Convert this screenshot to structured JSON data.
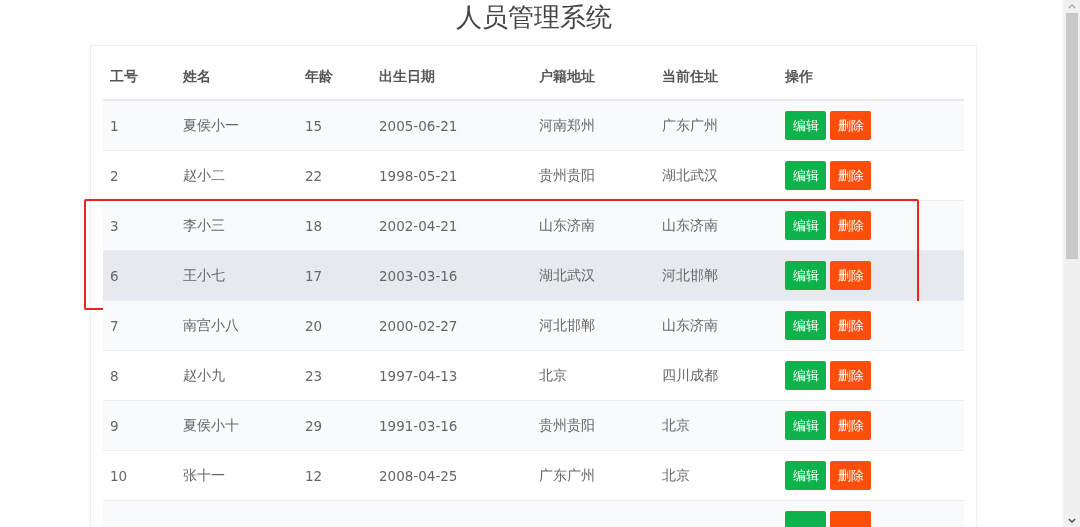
{
  "title": "人员管理系统",
  "table": {
    "columns": [
      "工号",
      "姓名",
      "年龄",
      "出生日期",
      "户籍地址",
      "当前住址",
      "操作"
    ],
    "rows": [
      {
        "cells": [
          "1",
          "夏侯小一",
          "15",
          "2005-06-21",
          "河南郑州",
          "广东广州"
        ],
        "actions": [
          "编辑",
          "删除"
        ],
        "hovered": false,
        "boxed": false
      },
      {
        "cells": [
          "2",
          "赵小二",
          "22",
          "1998-05-21",
          "贵州贵阳",
          "湖北武汉"
        ],
        "actions": [
          "编辑",
          "删除"
        ],
        "hovered": false,
        "boxed": false
      },
      {
        "cells": [
          "3",
          "李小三",
          "18",
          "2002-04-21",
          "山东济南",
          "山东济南"
        ],
        "actions": [
          "编辑",
          "删除"
        ],
        "hovered": false,
        "boxed": true
      },
      {
        "cells": [
          "6",
          "王小七",
          "17",
          "2003-03-16",
          "湖北武汉",
          "河北邯郸"
        ],
        "actions": [
          "编辑",
          "删除"
        ],
        "hovered": true,
        "boxed": true
      },
      {
        "cells": [
          "7",
          "南宫小八",
          "20",
          "2000-02-27",
          "河北邯郸",
          "山东济南"
        ],
        "actions": [
          "编辑",
          "删除"
        ],
        "hovered": false,
        "boxed": false
      },
      {
        "cells": [
          "8",
          "赵小九",
          "23",
          "1997-04-13",
          "北京",
          "四川成都"
        ],
        "actions": [
          "编辑",
          "删除"
        ],
        "hovered": false,
        "boxed": false
      },
      {
        "cells": [
          "9",
          "夏侯小十",
          "29",
          "1991-03-16",
          "贵州贵阳",
          "北京"
        ],
        "actions": [
          "编辑",
          "删除"
        ],
        "hovered": false,
        "boxed": false
      },
      {
        "cells": [
          "10",
          "张十一",
          "12",
          "2008-04-25",
          "广东广州",
          "北京"
        ],
        "actions": [
          "编辑",
          "删除"
        ],
        "hovered": false,
        "boxed": false
      },
      {
        "kind": "cut",
        "hovered": false,
        "boxed": false
      }
    ]
  }
}
